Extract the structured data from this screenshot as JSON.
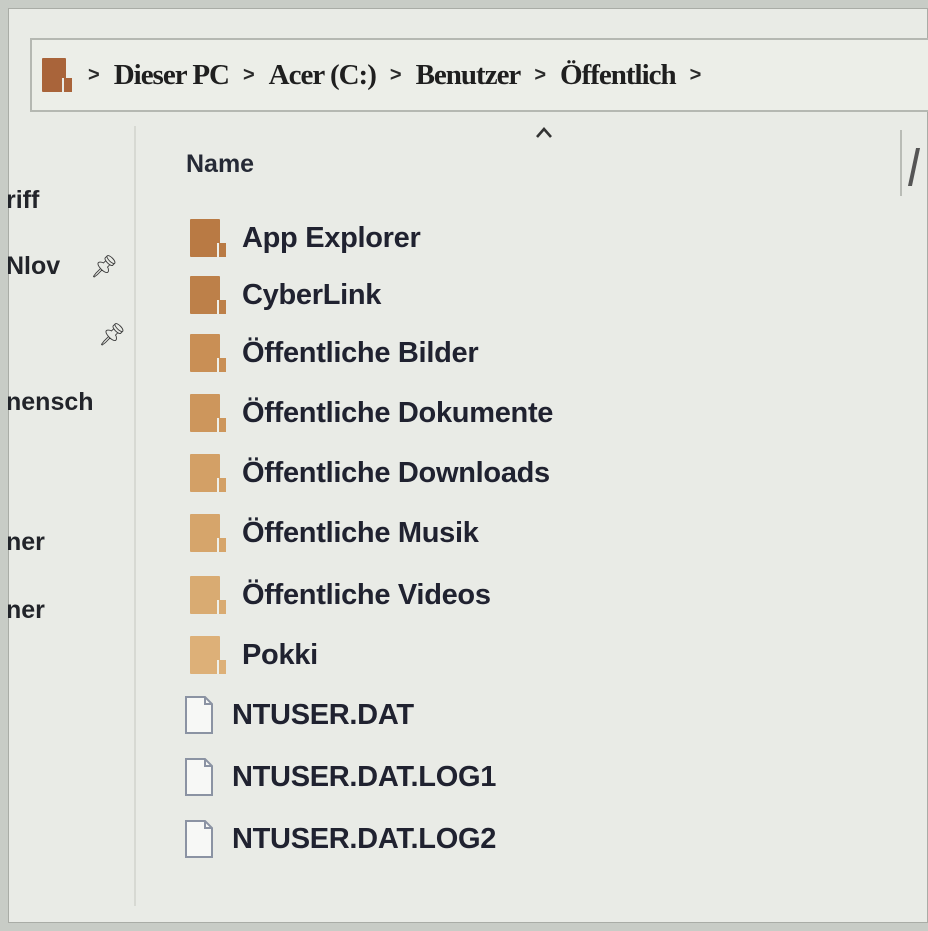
{
  "address_bar": {
    "separator": ">",
    "crumbs": [
      "Dieser PC",
      "Acer (C:)",
      "Benutzer",
      "Öffentlich"
    ],
    "folder_color": "#a9643a"
  },
  "nav_pane": {
    "items": [
      "riff",
      "Nlov",
      "nensch",
      "ner",
      "ner"
    ],
    "pin_icon": "pin-icon"
  },
  "columns": {
    "name_header": "Name",
    "sort_direction": "ascending"
  },
  "files": [
    {
      "name": "App Explorer",
      "type": "folder",
      "color": "#b97a44"
    },
    {
      "name": "CyberLink",
      "type": "folder",
      "color": "#bd8049"
    },
    {
      "name": "Öffentliche Bilder",
      "type": "folder",
      "color": "#c98f55"
    },
    {
      "name": "Öffentliche Dokumente",
      "type": "folder",
      "color": "#cd965c"
    },
    {
      "name": "Öffentliche Downloads",
      "type": "folder",
      "color": "#d3a066"
    },
    {
      "name": "Öffentliche Musik",
      "type": "folder",
      "color": "#d6a56b"
    },
    {
      "name": "Öffentliche Videos",
      "type": "folder",
      "color": "#d9ab72"
    },
    {
      "name": "Pokki",
      "type": "folder",
      "color": "#ddb078"
    },
    {
      "name": "NTUSER.DAT",
      "type": "file"
    },
    {
      "name": "NTUSER.DAT.LOG1",
      "type": "file"
    },
    {
      "name": "NTUSER.DAT.LOG2",
      "type": "file"
    }
  ]
}
